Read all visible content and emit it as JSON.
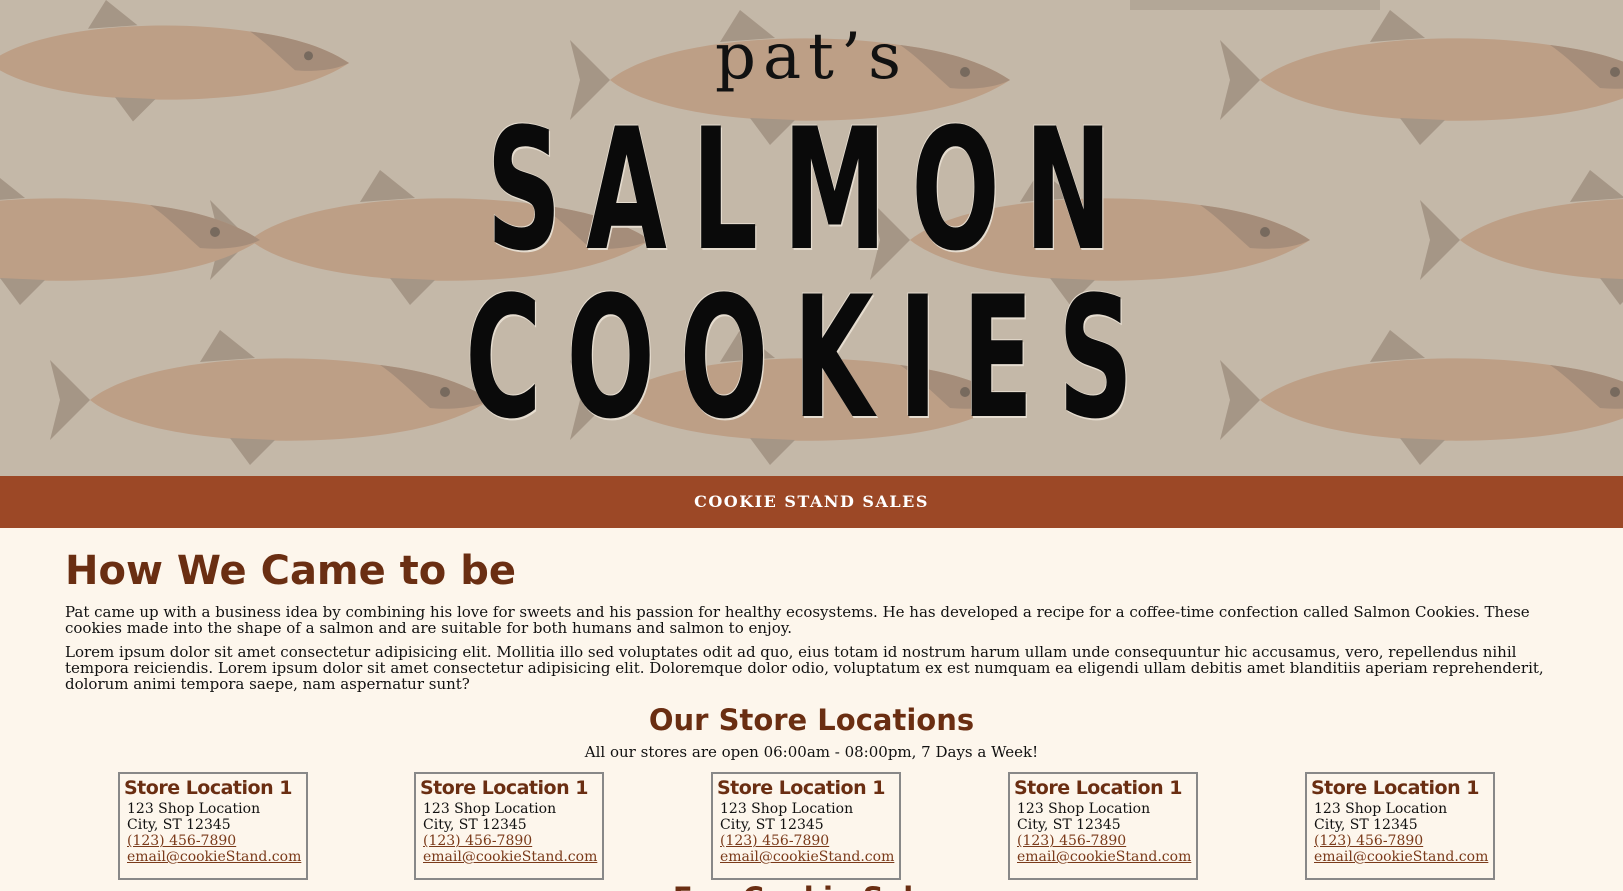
{
  "header": {
    "logo_small": "pat’s",
    "logo_line1": "SALMON",
    "logo_line2": "COOKIES"
  },
  "nav": {
    "link": "COOKIE STAND SALES"
  },
  "about": {
    "title": "How We Came to be",
    "paragraph1": "Pat came up with a business idea by combining his love for sweets and his passion for healthy ecosystems. He has developed a recipe for a coffee-time confection called Salmon Cookies. These cookies made into the shape of a salmon and are suitable for both humans and salmon to enjoy.",
    "paragraph2": "Lorem ipsum dolor sit amet consectetur adipisicing elit. Mollitia illo sed voluptates odit ad quo, eius totam id nostrum harum ullam unde consequuntur hic accusamus, vero, repellendus nihil tempora reiciendis. Lorem ipsum dolor sit amet consectetur adipisicing elit. Doloremque dolor odio, voluptatum ex est numquam ea eligendi ullam debitis amet blanditiis aperiam reprehenderit, dolorum animi tempora saepe, nam aspernatur sunt?"
  },
  "locations": {
    "title": "Our Store Locations",
    "hours": "All our stores are open 06:00am - 08:00pm, 7 Days a Week!",
    "stores": [
      {
        "name": "Store Location 1",
        "address": "123 Shop Location",
        "city": "City, ST 12345",
        "phone": "(123) 456-7890",
        "email": "email@cookieStand.com"
      },
      {
        "name": "Store Location 1",
        "address": "123 Shop Location",
        "city": "City, ST 12345",
        "phone": "(123) 456-7890",
        "email": "email@cookieStand.com"
      },
      {
        "name": "Store Location 1",
        "address": "123 Shop Location",
        "city": "City, ST 12345",
        "phone": "(123) 456-7890",
        "email": "email@cookieStand.com"
      },
      {
        "name": "Store Location 1",
        "address": "123 Shop Location",
        "city": "City, ST 12345",
        "phone": "(123) 456-7890",
        "email": "email@cookieStand.com"
      },
      {
        "name": "Store Location 1",
        "address": "123 Shop Location",
        "city": "City, ST 12345",
        "phone": "(123) 456-7890",
        "email": "email@cookieStand.com"
      }
    ]
  },
  "next_section": {
    "title_partial": "Fun Cookie Sales"
  },
  "colors": {
    "nav_bg": "#9c4826",
    "heading": "#6a2e12",
    "page_bg": "#fdf6ec",
    "hero_bg": "#c4b8a8"
  }
}
